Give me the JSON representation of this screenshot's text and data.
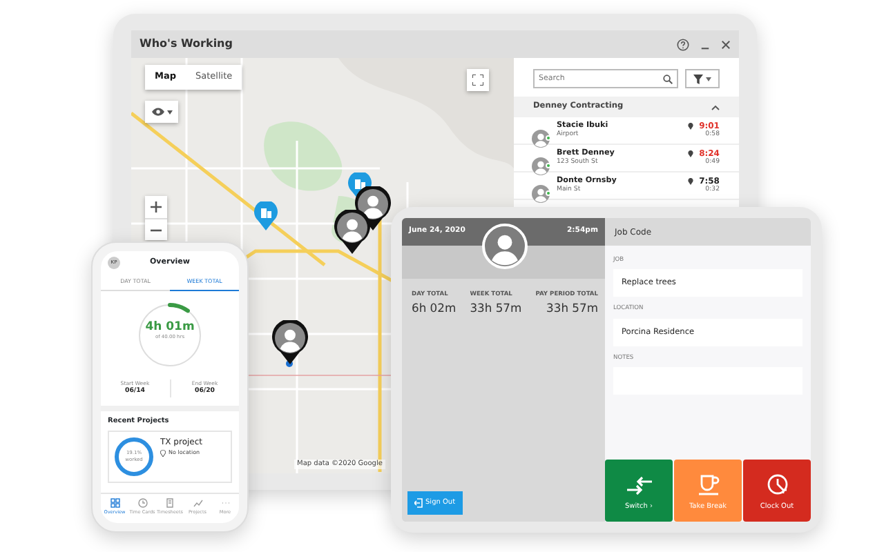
{
  "back_window": {
    "title": "Who's Working",
    "map": {
      "view_tabs": [
        {
          "label": "Map",
          "selected": true
        },
        {
          "label": "Satellite",
          "selected": false
        }
      ],
      "attribution": "Map data ©2020 Google"
    },
    "search": {
      "placeholder": "Search"
    },
    "groups": [
      {
        "name": "Denney Contracting",
        "expanded": true,
        "employees": [
          {
            "name": "Stacie Ibuki",
            "location": "Airport",
            "time": "9:01",
            "duration": "0:58",
            "alert": true,
            "online": true
          },
          {
            "name": "Brett Denney",
            "location": "123 South St",
            "time": "8:24",
            "duration": "0:49",
            "alert": true,
            "online": true
          },
          {
            "name": "Donte Ornsby",
            "location": "Main St",
            "time": "7:58",
            "duration": "0:32",
            "alert": false,
            "online": true
          }
        ]
      }
    ]
  },
  "phone": {
    "avatar": "KP",
    "title": "Overview",
    "tabs": [
      {
        "label": "DAY TOTAL",
        "selected": false
      },
      {
        "label": "WEEK TOTAL",
        "selected": true
      }
    ],
    "total": "4h 01m",
    "total_of": "of 40.00 hrs",
    "level": 0.1,
    "week": [
      {
        "label": "Start Week",
        "value": "06/14"
      },
      {
        "label": "End Week",
        "value": "06/20"
      }
    ],
    "section": "Recent Projects",
    "project": {
      "percent": "19.1%",
      "percent_label": "worked",
      "name": "TX project",
      "location": "No location"
    },
    "nav": [
      {
        "label": "Overview",
        "selected": true
      },
      {
        "label": "Time Cards",
        "selected": false
      },
      {
        "label": "Timesheets",
        "selected": false
      },
      {
        "label": "Projects",
        "selected": false
      },
      {
        "label": "More",
        "selected": false
      }
    ]
  },
  "kiosk": {
    "date": "June 24, 2020",
    "time": "2:54pm",
    "stats": [
      {
        "label": "DAY TOTAL",
        "value": "6h 02m"
      },
      {
        "label": "WEEK TOTAL",
        "value": "33h 57m"
      },
      {
        "label": "PAY PERIOD TOTAL",
        "value": "33h 57m"
      }
    ],
    "sign_out": "Sign Out",
    "panel_title": "Job Code",
    "fields": [
      {
        "label": "JOB",
        "value": "Replace trees"
      },
      {
        "label": "LOCATION",
        "value": "Porcina Residence"
      },
      {
        "label": "NOTES"
      }
    ],
    "actions": [
      {
        "label": "Switch ›",
        "kind": "switch"
      },
      {
        "label": "Take Break",
        "kind": "break"
      },
      {
        "label": "Clock Out",
        "kind": "clock-out"
      }
    ]
  }
}
